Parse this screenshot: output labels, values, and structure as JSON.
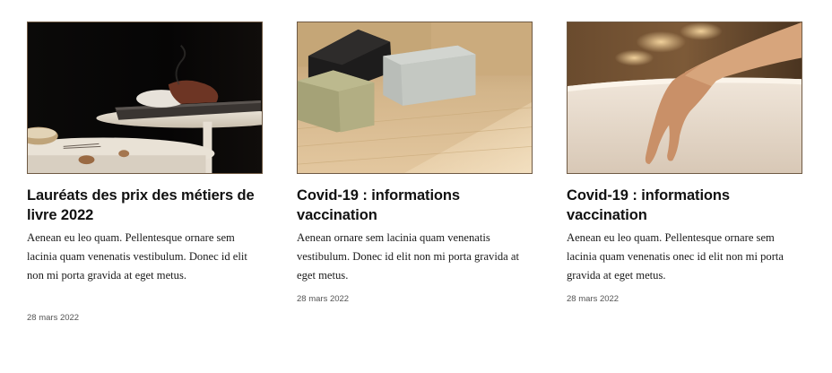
{
  "articles": [
    {
      "image": "incense-table-photo",
      "title": "Lauréats des prix des métiers de livre 2022",
      "excerpt": "Aenean eu leo quam. Pellentesque ornare sem lacinia quam venenatis vestibulum. Donec id elit non mi porta gravida at eget metus.",
      "date": "28 mars 2022"
    },
    {
      "image": "soap-bars-photo",
      "title": "Covid-19 : informations vaccination",
      "excerpt": "Aenean ornare sem lacinia quam venenatis vestibulum. Donec id elit non mi porta gravida at eget metus.",
      "date": "28 mars 2022"
    },
    {
      "image": "hand-bath-photo",
      "title": "Covid-19 : informations vaccination",
      "excerpt": "Aenean eu leo quam. Pellentesque ornare sem lacinia quam venenatis onec id elit non mi porta gravida at eget metus.",
      "date": "28 mars 2022"
    }
  ]
}
